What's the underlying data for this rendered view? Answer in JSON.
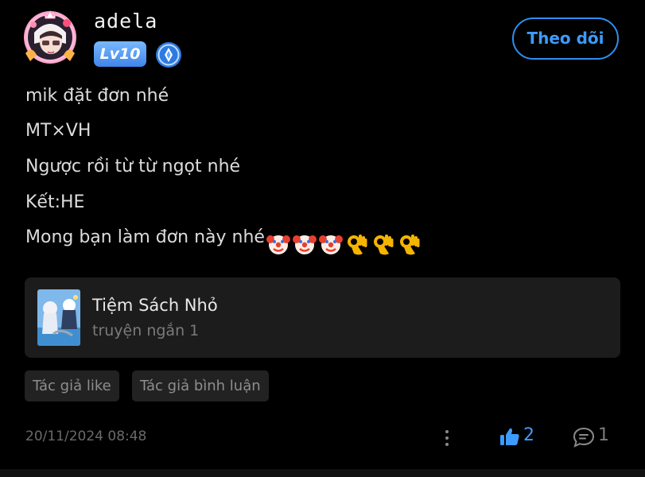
{
  "author": {
    "username": "adela",
    "level_badge": "Lv10",
    "follow_label": "Theo dõi"
  },
  "content": {
    "lines": [
      "mik đặt đơn nhé",
      "MT×VH",
      "Ngược rồi từ từ ngọt nhé",
      "Kết:HE",
      "Mong bạn làm đơn này nhé"
    ],
    "emojis": [
      "clown-face",
      "clown-face",
      "clown-face",
      "ok-hand",
      "ok-hand",
      "ok-hand"
    ]
  },
  "linked_book": {
    "title": "Tiệm Sách Nhỏ",
    "subtitle": "truyện ngắn 1"
  },
  "tags": [
    "Tác giả like",
    "Tác giả bình luận"
  ],
  "footer": {
    "timestamp": "20/11/2024 08:48",
    "like_count": "2",
    "comment_count": "1"
  },
  "colors": {
    "accent": "#3d9bff",
    "background": "#000000",
    "card": "#1c1c1c"
  }
}
